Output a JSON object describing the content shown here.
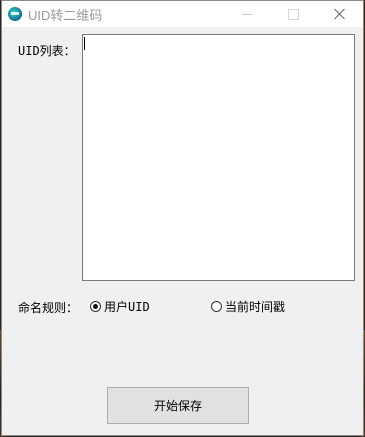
{
  "window": {
    "title": "UID转二维码",
    "app_icon": "qr-app-icon"
  },
  "titlebar_buttons": {
    "minimize": "minimize-icon",
    "maximize": "maximize-icon",
    "close": "close-icon"
  },
  "form": {
    "uid_list_label": "UID列表：",
    "uid_list_value": "",
    "naming_rule_label": "命名规则：",
    "naming_options": [
      {
        "label": "用户UID",
        "checked": true
      },
      {
        "label": "当前时间戳",
        "checked": false
      }
    ],
    "start_button": "开始保存"
  }
}
